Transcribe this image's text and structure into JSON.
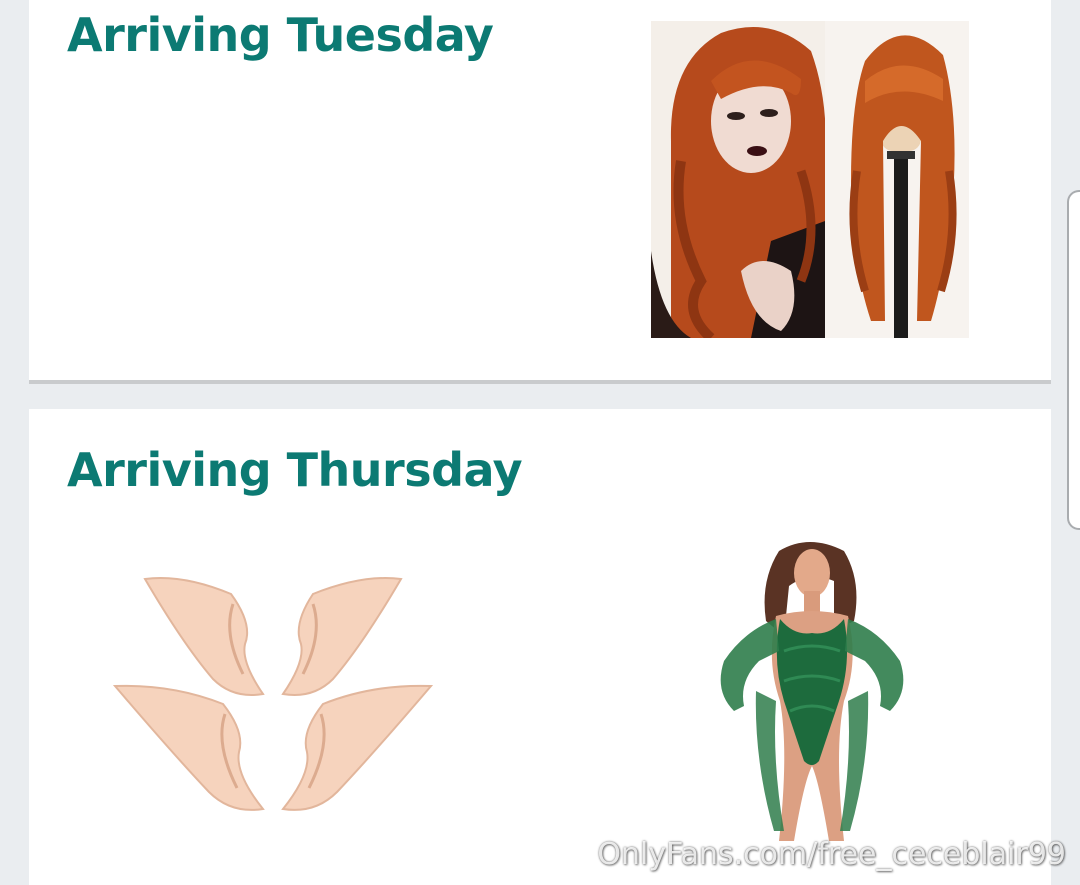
{
  "sections": [
    {
      "heading": "Arriving Tuesday"
    },
    {
      "heading": "Arriving Thursday"
    }
  ],
  "colors": {
    "heading": "#0c7a73",
    "page_background": "#eaedf0",
    "card_background": "#ffffff"
  },
  "products": [
    {
      "name": "auburn-wavy-wig-image",
      "section": "Arriving Tuesday"
    },
    {
      "name": "elf-ears-image",
      "section": "Arriving Thursday"
    },
    {
      "name": "green-lace-bodysuit-image",
      "section": "Arriving Thursday"
    }
  ],
  "watermark": "OnlyFans.com/free_ceceblair99"
}
